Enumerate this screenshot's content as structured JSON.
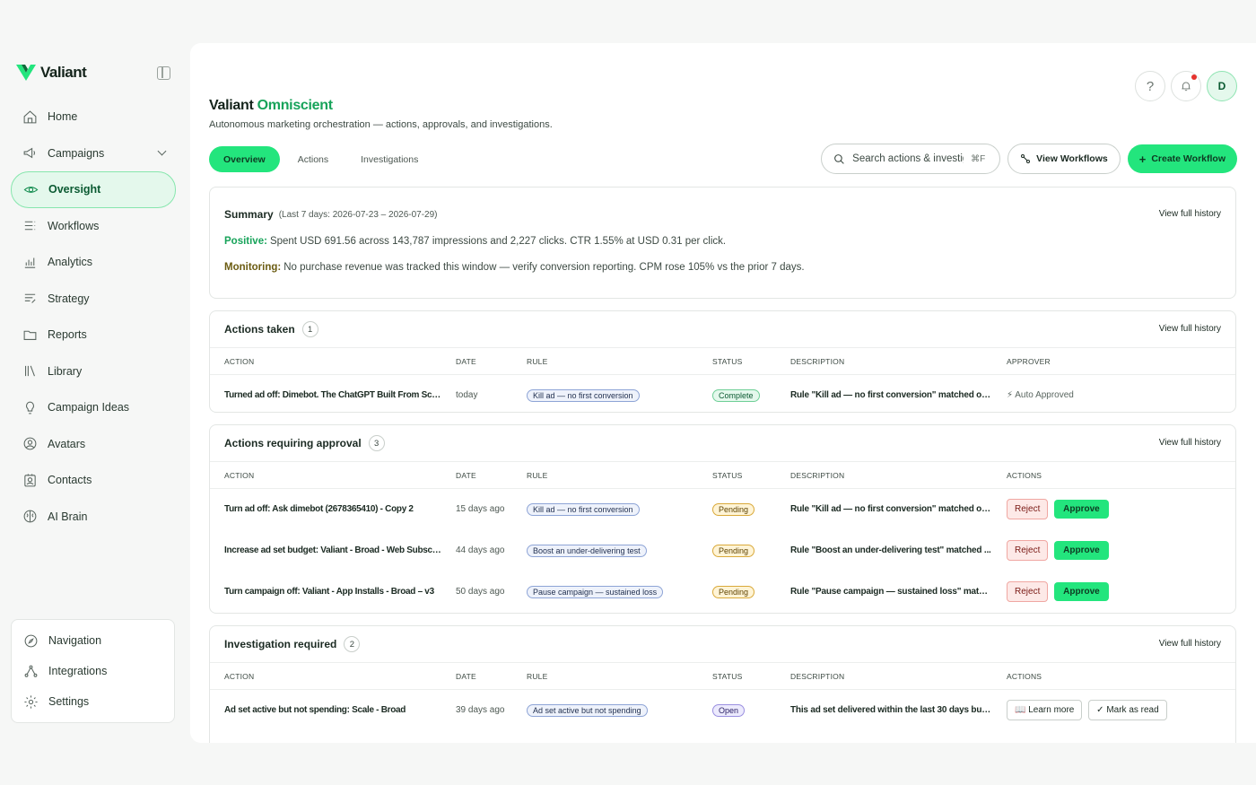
{
  "brand": {
    "name": "Valiant",
    "color": "#23e57d"
  },
  "sidebar": {
    "items": [
      {
        "label": "Home",
        "icon": "home-icon"
      },
      {
        "label": "Campaigns",
        "icon": "megaphone-icon"
      },
      {
        "label": "Oversight",
        "icon": "eye-icon"
      },
      {
        "label": "Workflows",
        "icon": "list-icon"
      },
      {
        "label": "Analytics",
        "icon": "bar-chart-icon"
      },
      {
        "label": "Strategy",
        "icon": "strategy-icon"
      },
      {
        "label": "Reports",
        "icon": "folder-icon"
      },
      {
        "label": "Library",
        "icon": "library-icon"
      },
      {
        "label": "Campaign Ideas",
        "icon": "lightbulb-icon"
      },
      {
        "label": "Avatars",
        "icon": "user-circle-icon"
      },
      {
        "label": "Contacts",
        "icon": "contact-icon"
      },
      {
        "label": "AI Brain",
        "icon": "brain-icon"
      }
    ],
    "bottom": [
      {
        "label": "Navigation",
        "icon": "compass-icon"
      },
      {
        "label": "Integrations",
        "icon": "integrations-icon"
      },
      {
        "label": "Settings",
        "icon": "gear-icon"
      }
    ]
  },
  "header": {
    "help": "?",
    "avatar": "D",
    "title_prefix": "Valiant",
    "title_accent": "Omniscient",
    "subtitle": "Autonomous marketing orchestration — actions, approvals, and investigations."
  },
  "tabs": [
    "Overview",
    "Actions",
    "Investigations"
  ],
  "toolbar": {
    "search_placeholder": "Search actions & investigations",
    "search_shortcut": "⌘F",
    "view_workflows": "View Workflows",
    "create_workflow": "Create Workflow"
  },
  "summary": {
    "title": "Summary",
    "range": "(Last 7 days: 2026-07-23 – 2026-07-29)",
    "view_history": "View full history",
    "positive_label": "Positive:",
    "positive_text": "Spent USD 691.56 across 143,787 impressions and 2,227 clicks. CTR 1.55% at USD 0.31 per click.",
    "monitoring_label": "Monitoring:",
    "monitoring_text": "No purchase revenue was tracked this window — verify conversion reporting. CPM rose 105% vs the prior 7 days."
  },
  "actions_taken": {
    "title": "Actions taken",
    "count": "1",
    "view_history": "View full history",
    "columns": [
      "ACTION",
      "DATE",
      "RULE",
      "STATUS",
      "DESCRIPTION",
      "APPROVER"
    ],
    "rows": [
      {
        "action": "Turned ad off: Dimebot. The ChatGPT Built From Scra...",
        "date": "today",
        "rule": "Kill ad — no first conversion",
        "status": "Complete",
        "description": "Rule \"Kill ad — no first conversion\" matched ov...",
        "approver": "Auto Approved"
      }
    ]
  },
  "approvals": {
    "title": "Actions requiring approval",
    "count": "3",
    "view_history": "View full history",
    "columns": [
      "ACTION",
      "DATE",
      "RULE",
      "STATUS",
      "DESCRIPTION",
      "ACTIONS"
    ],
    "reject_label": "Reject",
    "approve_label": "Approve",
    "rows": [
      {
        "action": "Turn ad off: Ask dimebot (2678365410) - Copy 2",
        "date": "15 days ago",
        "rule": "Kill ad — no first conversion",
        "status": "Pending",
        "description": "Rule \"Kill ad — no first conversion\" matched ov..."
      },
      {
        "action": "Increase ad set budget: Valiant - Broad - Web Subscri...",
        "date": "44 days ago",
        "rule": "Boost an under-delivering test",
        "status": "Pending",
        "description": "Rule \"Boost an under-delivering test\" matched ..."
      },
      {
        "action": "Turn campaign off: Valiant - App Installs - Broad – v3",
        "date": "50 days ago",
        "rule": "Pause campaign — sustained loss",
        "status": "Pending",
        "description": "Rule \"Pause campaign — sustained loss\" match..."
      }
    ]
  },
  "investigations": {
    "title": "Investigation required",
    "count": "2",
    "view_history": "View full history",
    "columns": [
      "ACTION",
      "DATE",
      "RULE",
      "STATUS",
      "DESCRIPTION",
      "ACTIONS"
    ],
    "learn_more": "Learn more",
    "mark_read": "Mark as read",
    "rows": [
      {
        "action": "Ad set active but not spending: Scale - Broad",
        "date": "39 days ago",
        "rule": "Ad set active but not spending",
        "status": "Open",
        "description": "This ad set delivered within the last 30 days but ..."
      }
    ]
  }
}
